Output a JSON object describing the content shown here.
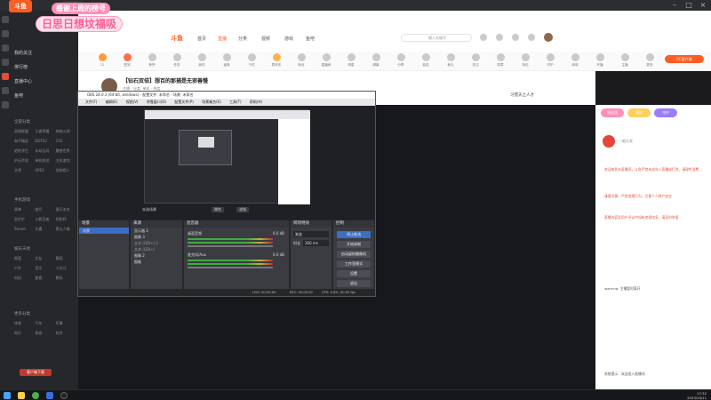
{
  "browser": {
    "tab_title": "斗鱼",
    "logo_text": "斗鱼",
    "logo_sub": "DOUYU.COM"
  },
  "banner": {
    "line1": "感谢上周的榜号",
    "line2": "日思日想坟福吸"
  },
  "header": {
    "logo": "斗鱼",
    "nav": [
      "首页",
      "直播",
      "分类",
      "视频",
      "游戏",
      "鱼吧"
    ],
    "search_placeholder": "输入关键字",
    "promo_badge": "PC客户端"
  },
  "toolbar": {
    "items": [
      "12",
      "签到",
      "荣誉",
      "任务",
      "我的",
      "道具",
      "个性",
      "周年庆",
      "粉丝",
      "直播间",
      "明星",
      "弹幕",
      "分享",
      "抽奖",
      "鱼丸",
      "关注",
      "勋章",
      "背包",
      "守护",
      "商城",
      "开播",
      "主播",
      "更多"
    ]
  },
  "room": {
    "title": "【钻石双倍】想百的那捕是无邪善慢",
    "meta": "主播 · 分类: 单机 · 热度",
    "host_tag": "习惯天之人才"
  },
  "sidebar": {
    "sections": [
      {
        "title": "我的关注",
        "items": [
          "我的关注",
          "排行榜",
          "直播中心",
          "鱼吧"
        ]
      },
      {
        "title": "全部分类",
        "items": [
          "英雄联盟",
          "王者荣耀",
          "穿越火线",
          "和平精英",
          "DOTA2",
          "CS2",
          "绝地求生",
          "永劫无间",
          "魔兽世界",
          "炉石传说",
          "单机热游",
          "主机游戏",
          "文明",
          "APEX",
          "怪物猎人"
        ]
      },
      {
        "title": "手机游戏",
        "items": [
          "原神",
          "崩坏",
          "蛋仔派对",
          "金铲铲",
          "火影忍者",
          "阴阳师",
          "Steam",
          "光遇",
          "第五人格"
        ]
      },
      {
        "title": "娱乐天地",
        "items": [
          "颜值",
          "交友",
          "舞蹈",
          "户外",
          "音乐",
          "二次元",
          "科技",
          "美食",
          "数码"
        ]
      },
      {
        "title": "更多分类",
        "items": [
          "体育",
          "汽车",
          "军事",
          "知识",
          "旅游",
          "综合"
        ]
      }
    ],
    "download_button": "客户端下载"
  },
  "obs": {
    "window_title": "OBS 28.0.3 (64-bit, windows) - 配置文件: 未命名 - 场景: 未命名",
    "menu": [
      "文件(F)",
      "编辑(E)",
      "视图(V)",
      "停靠窗口(D)",
      "配置文件(P)",
      "场景集合(S)",
      "工具(T)",
      "帮助(H)"
    ],
    "scene_label": "未选场景",
    "tabs": [
      "属性",
      "滤镜"
    ],
    "docks": {
      "scenes": {
        "title": "场景",
        "items": [
          "场景"
        ]
      },
      "sources": {
        "title": "来源",
        "items": [
          "显示器 2",
          "图像 3",
          "文本 (GDI+) 2",
          "文本 (GDI+)",
          "图像 2",
          "图像"
        ]
      },
      "mixer": {
        "title": "混音器",
        "channels": [
          {
            "name": "桌面音频",
            "level": "0.0 dB"
          },
          {
            "name": "麦克风/Aux",
            "level": "0.0 dB"
          }
        ]
      },
      "transitions": {
        "title": "转场特效",
        "mode": "渐变",
        "duration_label": "时长",
        "duration": "300 ms"
      },
      "controls": {
        "title": "控制",
        "buttons": [
          "停止推流",
          "开始录制",
          "启动虚拟摄像机",
          "工作室模式",
          "设置",
          "退出"
        ]
      }
    },
    "status": {
      "live": "LIVE: 00:00:00",
      "rec": "REC: 00:00:00",
      "cpu": "CPU: 0.8%, 60.00 fps"
    }
  },
  "chat": {
    "header_badges": [
      "粉丝团",
      "贵族",
      "守护"
    ],
    "messages": [
      "欢迎来到本直播间，斗鱼严禁未成年人直播或打赏，请理性消费",
      "谨慎兑换，严禁违规行为，注意个人财产安全",
      "直播内容及用户评论中如有违规信息，请及时举报",
      "warning: 主播暂时离开",
      "系统提示：欢迎进入直播间"
    ],
    "user_tags": [
      "一般大发",
      "正在观看",
      "新人"
    ]
  },
  "taskbar": {
    "time": "17:32",
    "date": "2023/10/11"
  },
  "colors": {
    "accent": "#ff5d23",
    "pink": "#ff8fb8",
    "obs_selected": "#3c6ec4"
  }
}
